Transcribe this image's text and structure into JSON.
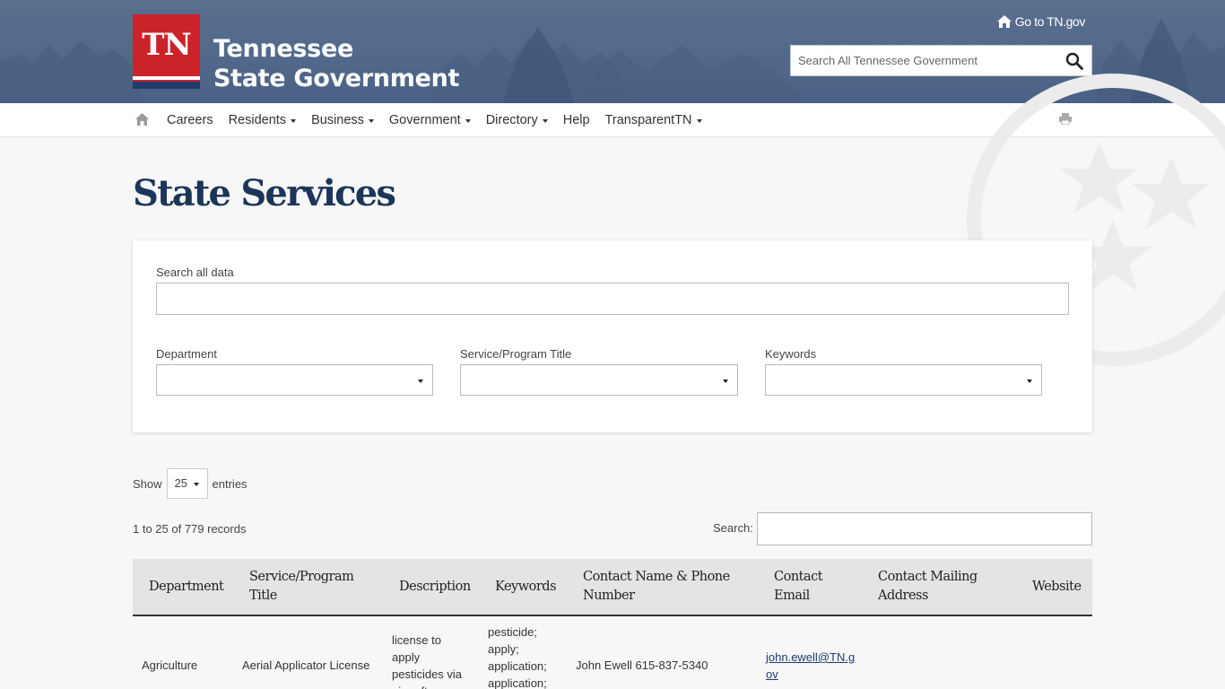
{
  "header": {
    "logo_mark": "TN",
    "logo_line1": "Tennessee",
    "logo_line2": "State Government",
    "goto_link": "Go to TN.gov",
    "search_placeholder": "Search All Tennessee Government"
  },
  "nav": {
    "items": [
      {
        "label": "Careers",
        "dropdown": false
      },
      {
        "label": "Residents",
        "dropdown": true
      },
      {
        "label": "Business",
        "dropdown": true
      },
      {
        "label": "Government",
        "dropdown": true
      },
      {
        "label": "Directory",
        "dropdown": true
      },
      {
        "label": "Help",
        "dropdown": false
      },
      {
        "label": "TransparentTN",
        "dropdown": true
      }
    ]
  },
  "page": {
    "title": "State Services"
  },
  "filters": {
    "search_label": "Search all data",
    "search_value": "",
    "department_label": "Department",
    "department_value": "",
    "program_label": "Service/Program Title",
    "program_value": "",
    "keywords_label": "Keywords",
    "keywords_value": ""
  },
  "table_controls": {
    "show_label": "Show",
    "page_length": "25",
    "entries_label": "entries",
    "records_info": "1 to 25 of 779 records",
    "search_label": "Search:"
  },
  "table": {
    "headers": {
      "department": "Department",
      "program_l1": "Service/Program",
      "program_l2": "Title",
      "description": "Description",
      "keywords": "Keywords",
      "contact_l1": "Contact Name & Phone",
      "contact_l2": "Number",
      "email_l1": "Contact",
      "email_l2": "Email",
      "mailing_l1": "Contact Mailing",
      "mailing_l2": "Address",
      "website": "Website"
    },
    "rows": [
      {
        "department": "Agriculture",
        "program": "Aerial Applicator License",
        "description_lines": [
          "license to",
          "apply",
          "pesticides via",
          "aircraft"
        ],
        "keywords_lines": [
          "pesticide;",
          "apply;",
          "application;",
          "application;"
        ],
        "contact": "John Ewell 615-837-5340",
        "email_l1": "john.ewell@TN.g",
        "email_l2": "ov",
        "mailing": "",
        "website": ""
      }
    ]
  },
  "colors": {
    "header_bg": "#52688a",
    "logo_red": "#cc2229",
    "logo_navy": "#1f3b6e",
    "title_navy": "#1c3559"
  }
}
